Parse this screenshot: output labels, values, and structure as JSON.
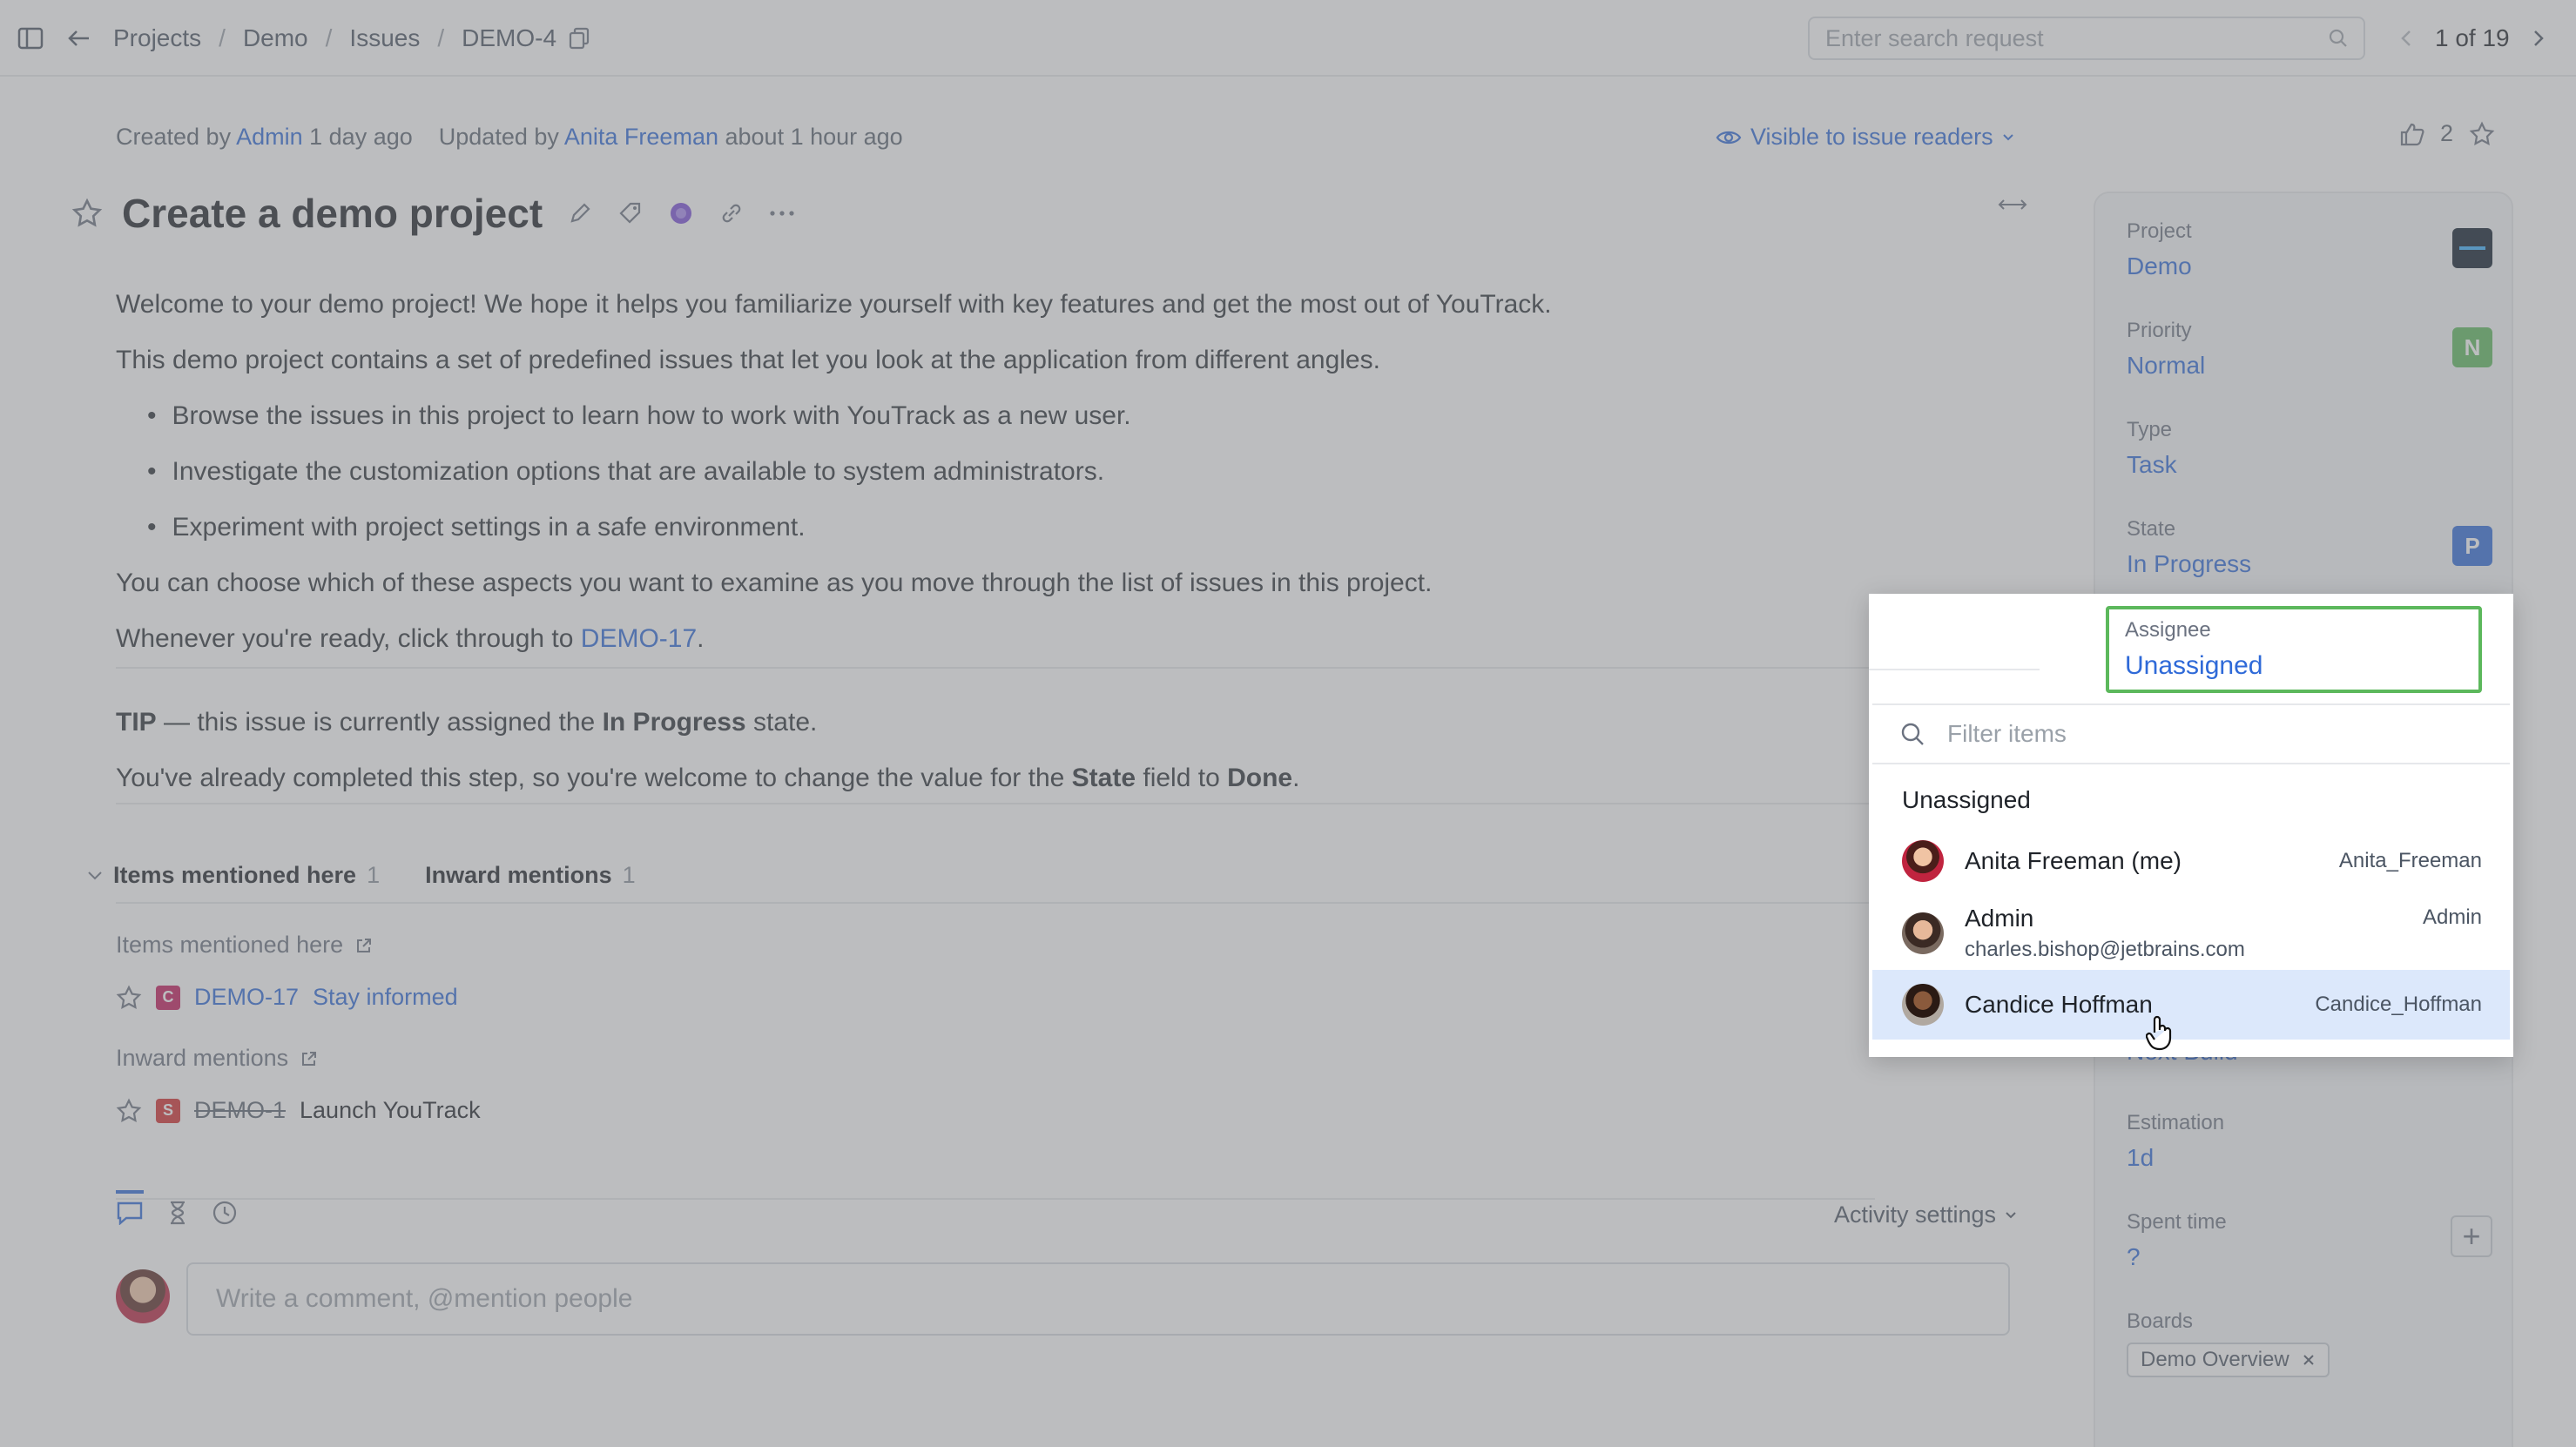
{
  "topbar": {
    "crumbs": [
      "Projects",
      "Demo",
      "Issues",
      "DEMO-4"
    ],
    "search_placeholder": "Enter search request",
    "pager": "1 of 19"
  },
  "issue": {
    "meta_created_prefix": "Created by",
    "meta_created_user": "Admin",
    "meta_created_time": "1 day ago",
    "meta_updated_prefix": "Updated by",
    "meta_updated_user": "Anita Freeman",
    "meta_updated_time": "about 1 hour ago",
    "visibility": "Visible to issue readers",
    "votes": "2",
    "title": "Create a demo project",
    "desc": {
      "p1": "Welcome to your demo project! We hope it helps you familiarize yourself with key features and get the most out of YouTrack.",
      "p2": "This demo project contains a set of predefined issues that let you look at the application from different angles.",
      "bullets": [
        "Browse the issues in this project to learn how to work with YouTrack as a new user.",
        "Investigate the customization options that are available to system administrators.",
        "Experiment with project settings in a safe environment."
      ],
      "p3": "You can choose which of these aspects you want to examine as you move through the list of issues in this project.",
      "p4_prefix": "Whenever you're ready, click through to",
      "p4_link": "DEMO-17",
      "p4_suffix": ".",
      "tip_label": "TIP",
      "tip_text1": " — this issue is currently assigned the ",
      "tip_bold": "In Progress",
      "tip_text2": " state.",
      "p6_prefix": "You've already completed this step, so you're welcome to change the value for the ",
      "p6_bold1": "State",
      "p6_mid": " field to ",
      "p6_bold2": "Done",
      "p6_suffix": "."
    }
  },
  "mentions": {
    "tab1_label": "Items mentioned here",
    "tab1_count": "1",
    "tab2_label": "Inward mentions",
    "tab2_count": "1",
    "section1_label": "Items mentioned here",
    "item1_badge": "C",
    "item1_id": "DEMO-17",
    "item1_title": "Stay informed",
    "section2_label": "Inward mentions",
    "item2_badge": "S",
    "item2_id": "DEMO-1",
    "item2_title": "Launch YouTrack"
  },
  "activity": {
    "settings_label": "Activity settings",
    "comment_placeholder": "Write a comment, @mention people"
  },
  "sidebar": {
    "project_label": "Project",
    "project_value": "Demo",
    "priority_label": "Priority",
    "priority_value": "Normal",
    "priority_chip": "N",
    "type_label": "Type",
    "type_value": "Task",
    "state_label": "State",
    "state_value": "In Progress",
    "state_chip": "P",
    "fixversion_value": "Next Build",
    "estimation_label": "Estimation",
    "estimation_value": "1d",
    "spent_label": "Spent time",
    "spent_value": "?",
    "boards_label": "Boards",
    "board_tag": "Demo Overview"
  },
  "popup": {
    "assignee_label": "Assignee",
    "assignee_value": "Unassigned",
    "filter_placeholder": "Filter items",
    "option_unassigned": "Unassigned",
    "options": [
      {
        "name": "Anita Freeman (me)",
        "login": "Anita_Freeman",
        "email": ""
      },
      {
        "name": "Admin",
        "login": "Admin",
        "email": "charles.bishop@jetbrains.com"
      },
      {
        "name": "Candice Hoffman",
        "login": "Candice_Hoffman",
        "email": ""
      }
    ]
  },
  "colors": {
    "link": "#2f6ad8",
    "focus_border": "#5cb85c",
    "hover_row": "#dce8fb",
    "priority_chip": "#5cb85c",
    "state_chip": "#2f6ad8",
    "badge_c": "#c2185b",
    "badge_s": "#d32f2f"
  }
}
